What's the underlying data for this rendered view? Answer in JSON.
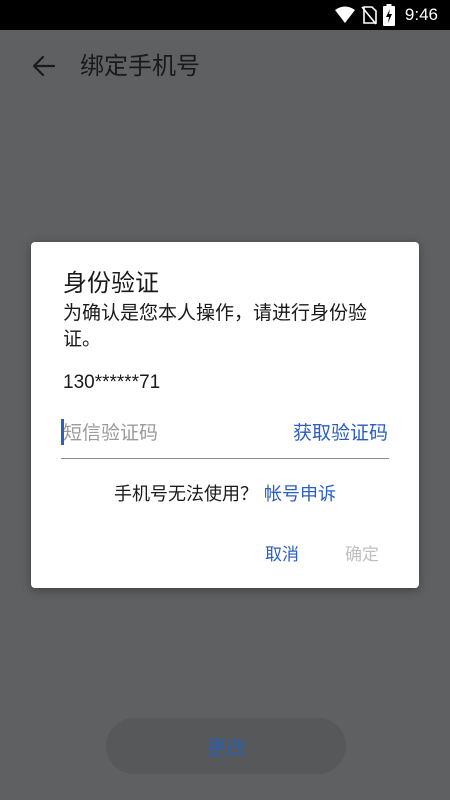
{
  "status_bar": {
    "time": "9:46"
  },
  "app_bar": {
    "title": "绑定手机号"
  },
  "bottom": {
    "change_label": "更改"
  },
  "dialog": {
    "title": "身份验证",
    "message": "为确认是您本人操作，请进行身份验证。",
    "phone": "130******71",
    "code_placeholder": "短信验证码",
    "get_code_label": "获取验证码",
    "help_text": "手机号无法使用？",
    "appeal_label": "帐号申诉",
    "cancel_label": "取消",
    "confirm_label": "确定"
  },
  "colors": {
    "accent": "#2a5ec0",
    "scrim": "#5f6062",
    "disabled": "#c0c0c0"
  }
}
